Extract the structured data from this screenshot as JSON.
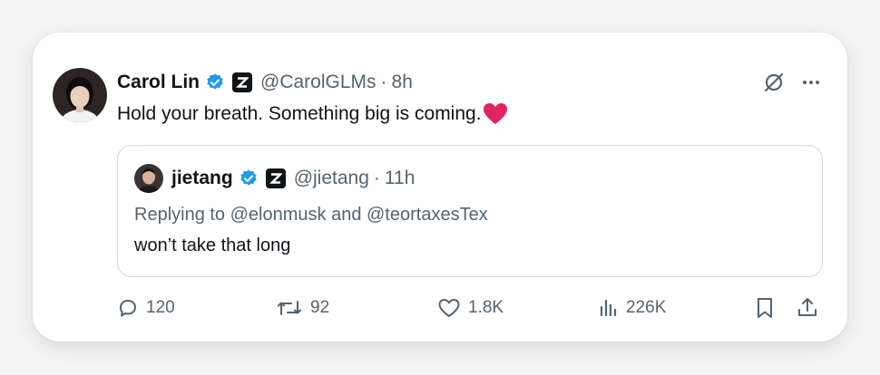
{
  "tweet": {
    "author_name": "Carol Lin",
    "handle": "@CarolGLMs",
    "separator": "·",
    "time": "8h",
    "text": "Hold your breath. Something big is coming.",
    "emoji": "heart"
  },
  "quote": {
    "author_name": "jietang",
    "handle": "@jietang",
    "separator": "·",
    "time": "11h",
    "reply_line": "Replying to @elonmusk and @teortaxesTex",
    "text": "won’t take that long"
  },
  "actions": {
    "replies": "120",
    "reposts": "92",
    "likes": "1.8K",
    "views": "226K"
  },
  "colors": {
    "verified_blue": "#1d9bf0",
    "text_primary": "#0f1419",
    "text_secondary": "#536471",
    "heart_red": "#e0245e"
  },
  "icons": [
    "verified-icon",
    "z-affiliate-icon",
    "grok-icon",
    "more-icon",
    "reply-icon",
    "repost-icon",
    "like-icon",
    "views-icon",
    "bookmark-icon",
    "share-icon"
  ]
}
